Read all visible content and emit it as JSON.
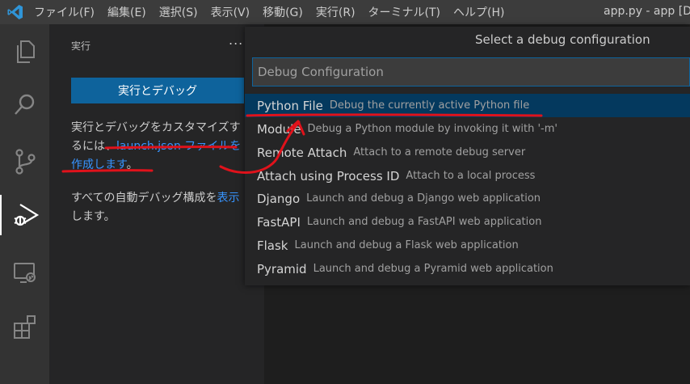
{
  "titlebar": {
    "menus": [
      "ファイル(F)",
      "編集(E)",
      "選択(S)",
      "表示(V)",
      "移動(G)",
      "実行(R)",
      "ターミナル(T)",
      "ヘルプ(H)"
    ],
    "window_title": "app.py - app [D"
  },
  "activity_bar": {
    "items": [
      "explorer-icon",
      "search-icon",
      "source-control-icon",
      "run-debug-icon",
      "remote-explorer-icon",
      "extensions-icon"
    ],
    "active": "run-debug-icon"
  },
  "sidebar": {
    "header": "実行",
    "more": "...",
    "run_button": "実行とデバッグ",
    "customize_text_1": "実行とデバッグをカスタマイズするには、",
    "customize_link": "launch.json ファイルを作成します",
    "customize_text_2": "。",
    "auto_text_1": "すべての自動デバッグ構成を",
    "auto_link": "表示",
    "auto_text_2": "します。"
  },
  "quick_pick": {
    "title": "Select a debug configuration",
    "placeholder": "Debug Configuration",
    "items": [
      {
        "label": "Python File",
        "description": "Debug the currently active Python file",
        "selected": true
      },
      {
        "label": "Module",
        "description": "Debug a Python module by invoking it with '-m'"
      },
      {
        "label": "Remote Attach",
        "description": "Attach to a remote debug server"
      },
      {
        "label": "Attach using Process ID",
        "description": "Attach to a local process"
      },
      {
        "label": "Django",
        "description": "Launch and debug a Django web application"
      },
      {
        "label": "FastAPI",
        "description": "Launch and debug a FastAPI web application"
      },
      {
        "label": "Flask",
        "description": "Launch and debug a Flask web application"
      },
      {
        "label": "Pyramid",
        "description": "Launch and debug a Pyramid web application"
      }
    ]
  },
  "colors": {
    "accent_button": "#0e639c",
    "link": "#3794ff",
    "selection": "#04395e",
    "annotation": "#e0121b"
  }
}
